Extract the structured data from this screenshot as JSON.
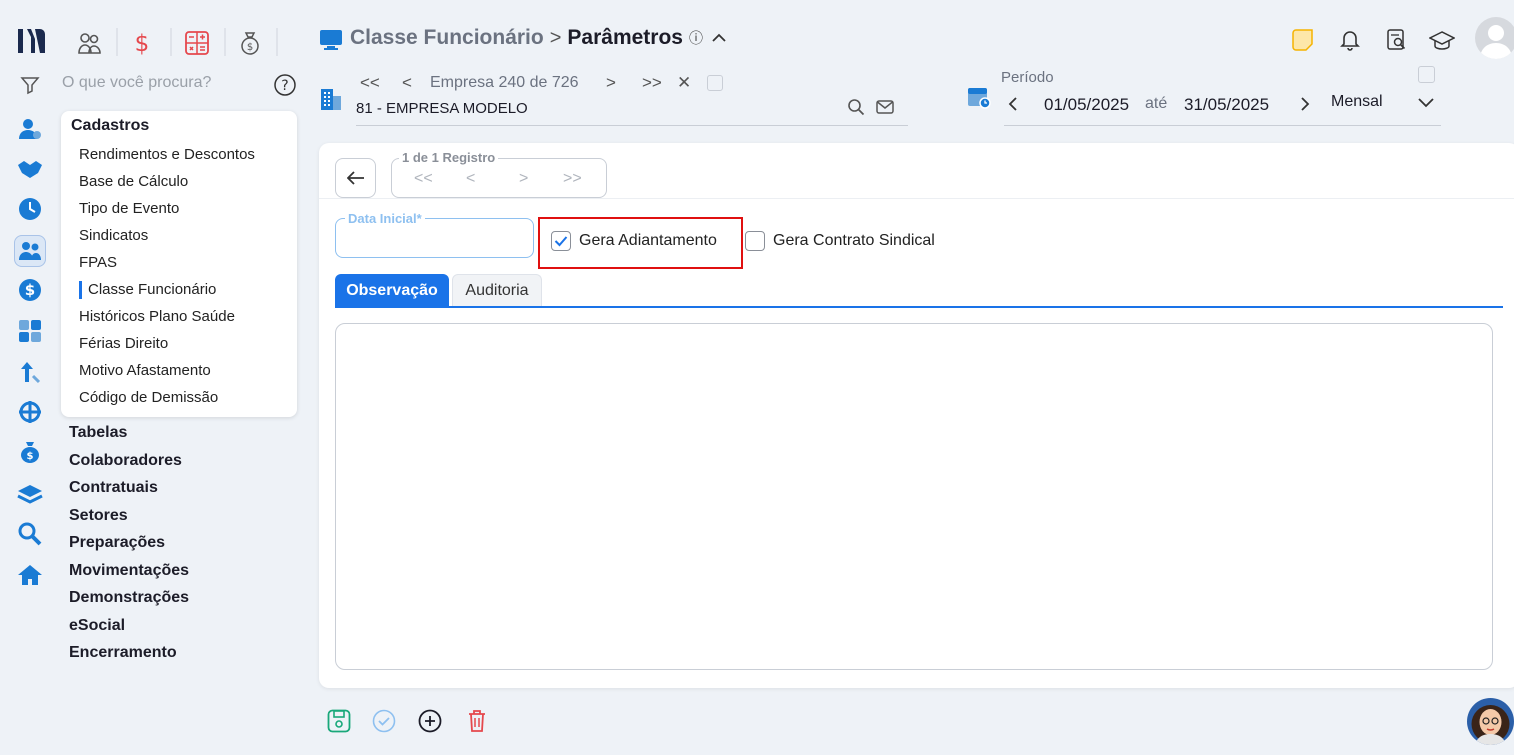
{
  "header": {
    "breadcrumb_parent": "Classe Funcionário",
    "breadcrumb_sep": ">",
    "page_title": "Parâmetros",
    "info_glyph": "ⓘ"
  },
  "top_tools": [
    "users-icon",
    "dollar-icon",
    "calculator-icon",
    "money-bag-icon"
  ],
  "search": {
    "placeholder": "O que você procura?"
  },
  "company": {
    "nav_first": "<<",
    "nav_prev": "<",
    "position_label": "Empresa 240 de 726",
    "nav_next": ">",
    "nav_last": ">>",
    "clear": "✕",
    "name": "81 - EMPRESA MODELO"
  },
  "period": {
    "label": "Período",
    "start": "01/05/2025",
    "sep": "até",
    "end": "31/05/2025",
    "mode": "Mensal"
  },
  "sidebar": {
    "expanded_title": "Cadastros",
    "items": [
      "Rendimentos e Descontos",
      "Base de Cálculo",
      "Tipo de Evento",
      "Sindicatos",
      "FPAS",
      "Classe Funcionário",
      "Históricos Plano Saúde",
      "Férias Direito",
      "Motivo Afastamento",
      "Código de Demissão"
    ],
    "active_index": 5,
    "sections": [
      "Tabelas",
      "Colaboradores",
      "Contratuais",
      "Setores",
      "Preparações",
      "Movimentações",
      "Demonstrações",
      "eSocial",
      "Encerramento"
    ]
  },
  "record_nav": {
    "label": "1 de 1 Registro",
    "first": "<<",
    "prev": "<",
    "next": ">",
    "last": ">>"
  },
  "form": {
    "data_inicial_label": "Data Inicial*",
    "data_inicial_value": "",
    "gera_adiantamento_label": "Gera Adiantamento",
    "gera_adiantamento_checked": true,
    "gera_contrato_label": "Gera Contrato Sindical",
    "gera_contrato_checked": false
  },
  "tabs": [
    {
      "label": "Observação",
      "active": true
    },
    {
      "label": "Auditoria",
      "active": false
    }
  ],
  "colors": {
    "accent": "#1a73e8",
    "highlight_border": "#e01010",
    "brand_dark": "#1b2a4e",
    "save_green": "#19a87a",
    "delete_red": "#e5484d"
  }
}
